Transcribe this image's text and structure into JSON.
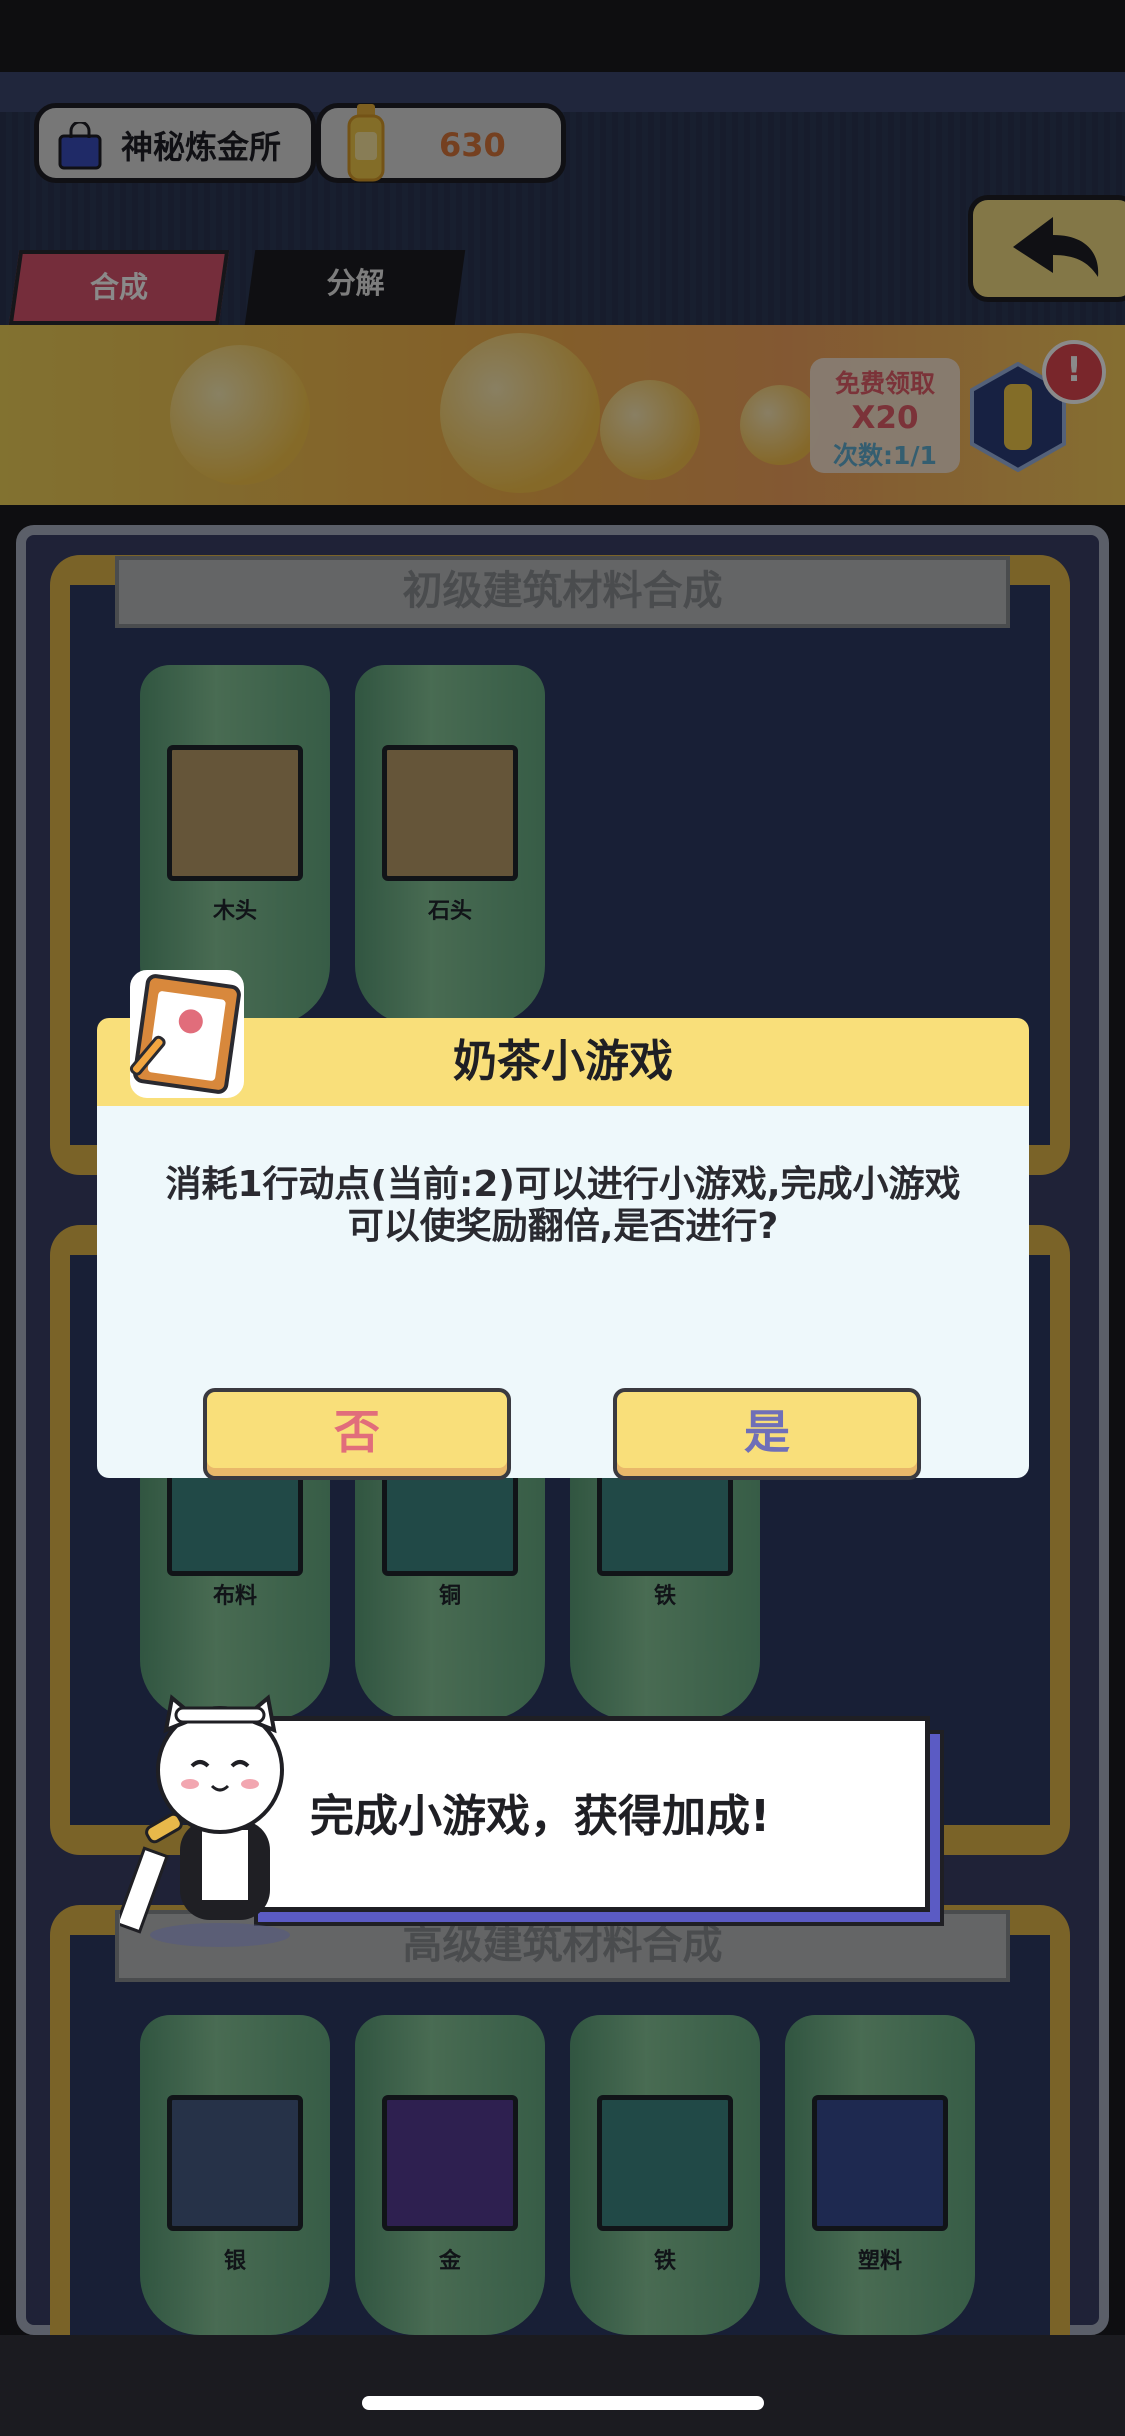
{
  "header": {
    "shop_name": "神秘炼金所",
    "currency": "630"
  },
  "tabs": [
    {
      "label": "合成"
    },
    {
      "label": "分解"
    }
  ],
  "banner": {
    "free_claim": "免费领取",
    "multiplier": "X20",
    "count": "次数:1/1",
    "alert": "!"
  },
  "sections": [
    {
      "title": "初级建筑材料合成",
      "items": [
        "木头",
        "石头"
      ]
    },
    {
      "title": "",
      "items": [
        "布料",
        "铜",
        "铁"
      ]
    },
    {
      "title": "高级建筑材料合成",
      "items": [
        "银",
        "金",
        "铁",
        "塑料"
      ]
    }
  ],
  "dialog": {
    "title": "奶茶小游戏",
    "message": "消耗1行动点(当前:2)可以进行小游戏,完成小游戏可以使奖励翻倍,是否进行?",
    "no": "否",
    "yes": "是"
  },
  "tip": {
    "text": "完成小游戏，获得加成!"
  },
  "colors": {
    "accent_yellow": "#f9df7a",
    "pink": "#e16d7b",
    "purple": "#6f6fb8",
    "tab_active": "#d8546d"
  }
}
